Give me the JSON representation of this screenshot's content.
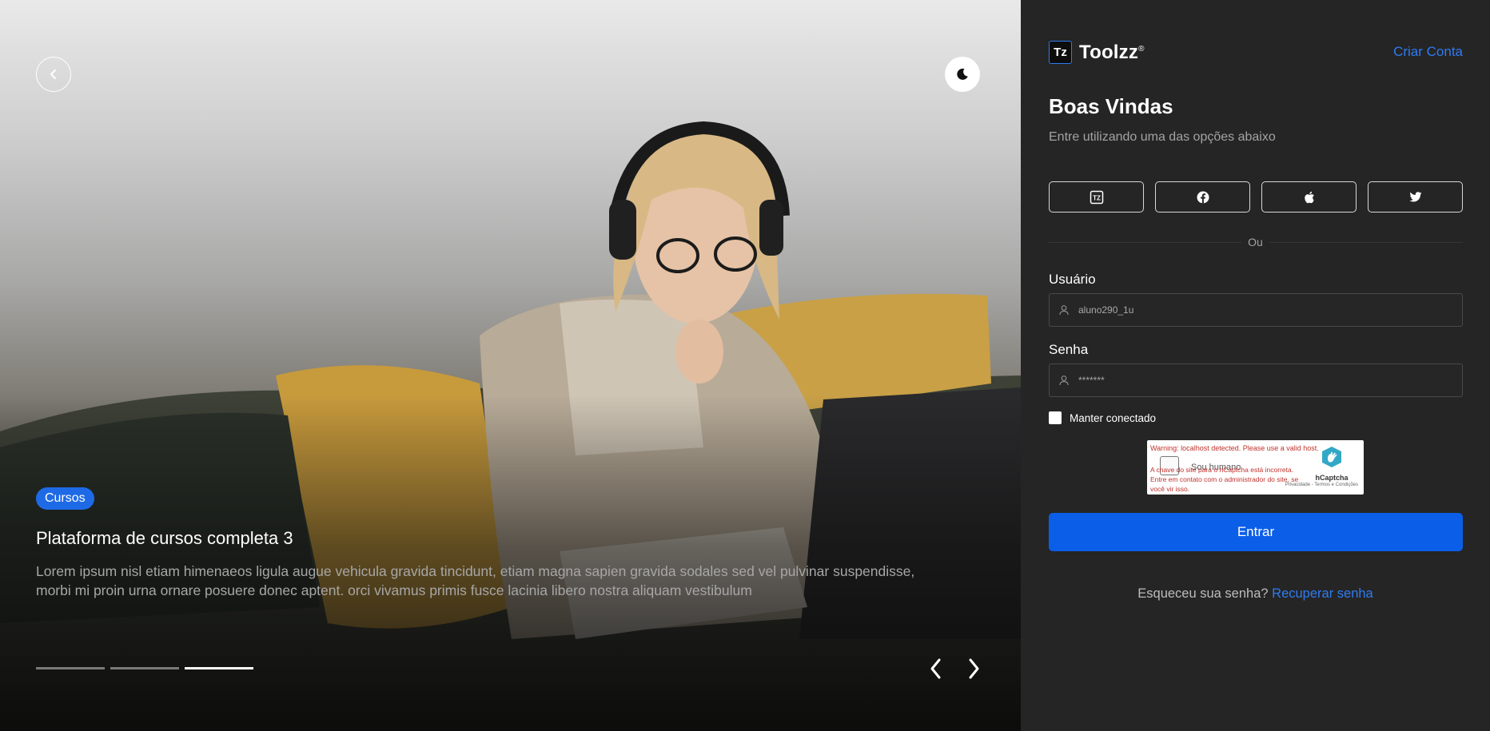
{
  "hero": {
    "badge": "Cursos",
    "title": "Plataforma de cursos completa 3",
    "description": "Lorem ipsum nisl etiam himenaeos ligula augue vehicula gravida tincidunt, etiam magna sapien gravida sodales sed vel pulvinar suspendisse, morbi mi proin urna ornare posuere donec aptent. orci vivamus primis fusce lacinia libero nostra aliquam vestibulum",
    "slides_total": 3,
    "active_slide": 3,
    "icons": {
      "back": "chevron-left-icon",
      "theme": "moon-icon",
      "prev": "chevron-left-icon",
      "next": "chevron-right-icon"
    }
  },
  "panel": {
    "brand": "Toolzz",
    "brand_mark": "Tz",
    "brand_registered": "®",
    "signup_link": "Criar Conta",
    "welcome": "Boas Vindas",
    "subtitle": "Entre utilizando uma das opções abaixo",
    "social_buttons": [
      "toolzz-icon",
      "facebook-icon",
      "apple-icon",
      "twitter-icon"
    ],
    "divider": "Ou",
    "username": {
      "label": "Usuário",
      "value": "aluno290_1u",
      "icon": "user-icon"
    },
    "password": {
      "label": "Senha",
      "value": "*******",
      "icon": "user-icon"
    },
    "remember_label": "Manter conectado",
    "remember_checked": false,
    "captcha": {
      "warning": "Warning: localhost detected. Please use a valid host.",
      "checkbox_label": "Sou humano",
      "error": "A chave do site para o hCaptcha está incorreta. Entre em contato com o administrador do site, se você vir isso.",
      "brand": "hCaptcha",
      "links": "Privacidade - Termos e Condições"
    },
    "submit": "Entrar",
    "forgot_text": "Esqueceu sua senha?",
    "recover_link": "Recuperar senha"
  },
  "colors": {
    "accent": "#0b5ee8",
    "link": "#2f7bf2",
    "panel_bg": "#252525",
    "badge": "#1e6ae6"
  }
}
